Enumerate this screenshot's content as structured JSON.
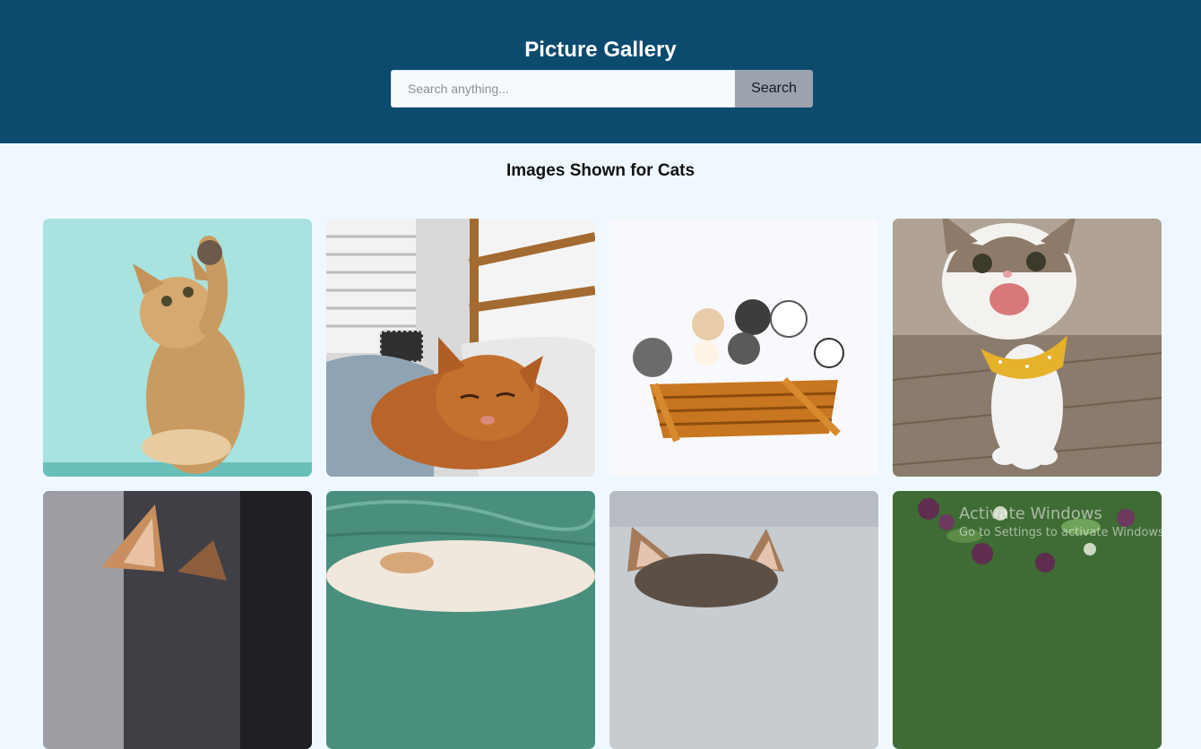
{
  "header": {
    "title": "Picture Gallery",
    "search": {
      "placeholder": "Search anything...",
      "value": "",
      "button_label": "Search"
    },
    "background_color": "#0c4a6e"
  },
  "results": {
    "heading": "Images Shown for Cats"
  },
  "gallery": {
    "images": [
      {
        "subject": "kitten-raising-paw"
      },
      {
        "subject": "sleeping-orange-cat"
      },
      {
        "subject": "kittens-in-basket"
      },
      {
        "subject": "smiling-cat-with-yellow-bandana"
      },
      {
        "subject": "cat-ears-closeup"
      },
      {
        "subject": "cat-on-green-background"
      },
      {
        "subject": "cat-ears-gray-background"
      },
      {
        "subject": "purple-flowers-and-leaves"
      }
    ]
  },
  "system_overlay": {
    "watermark_title": "Activate Windows",
    "watermark_subtitle": "Go to Settings to activate Windows."
  }
}
